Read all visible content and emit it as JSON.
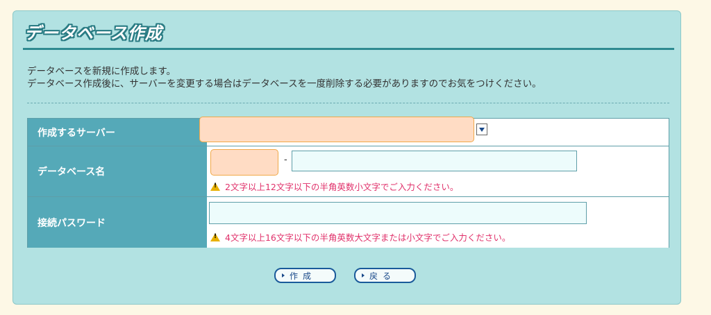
{
  "page": {
    "title": "データベース作成",
    "description_line1": "データベースを新規に作成します。",
    "description_line2": "データベース作成後に、サーバーを変更する場合はデータベースを一度削除する必要がありますのでお気をつけください。"
  },
  "form": {
    "server": {
      "label": "作成するサーバー",
      "selected_value": ""
    },
    "db_name": {
      "label": "データベース名",
      "prefix_value": "",
      "separator": "-",
      "value": "",
      "hint": "2文字以上12文字以下の半角英数小文字でご入力ください。"
    },
    "password": {
      "label": "接続パスワード",
      "value": "",
      "hint": "4文字以上16文字以下の半角英数大文字または小文字でご入力ください。"
    }
  },
  "buttons": {
    "create": "作成",
    "back": "戻る"
  },
  "icons": {
    "warning": "warning-icon",
    "select_arrow": "chevron-down-icon"
  }
}
